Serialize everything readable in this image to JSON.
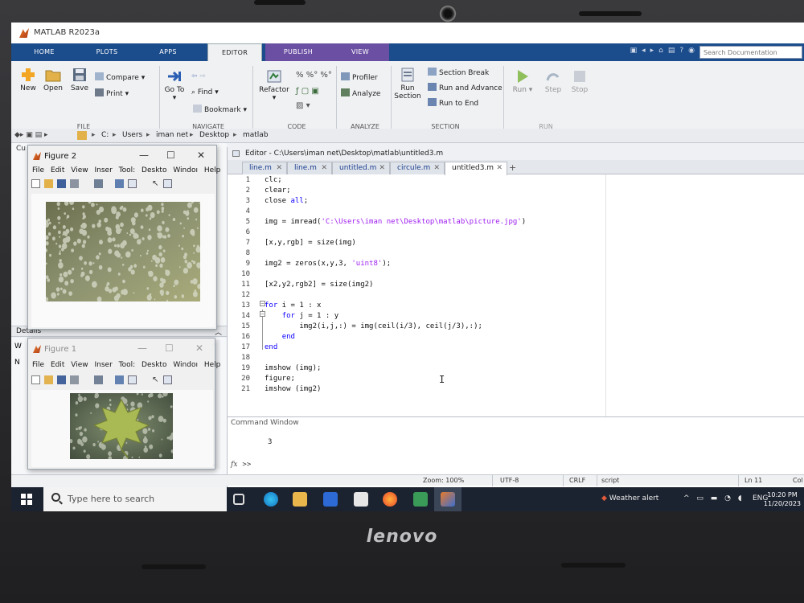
{
  "app": {
    "title": "MATLAB R2023a",
    "search_placeholder": "Search Documentation",
    "brand": "lenovo"
  },
  "tabs": [
    {
      "label": "HOME"
    },
    {
      "label": "PLOTS"
    },
    {
      "label": "APPS"
    },
    {
      "label": "EDITOR",
      "active": true
    },
    {
      "label": "PUBLISH"
    },
    {
      "label": "VIEW"
    }
  ],
  "ribbon": {
    "new": "New",
    "open": "Open",
    "save": "Save",
    "file_group": "FILE",
    "compare": "Compare",
    "print": "Print",
    "goto": "Go To",
    "find": "Find",
    "bookmark": "Bookmark",
    "navigate_group": "NAVIGATE",
    "refactor": "Refactor",
    "code_group": "CODE",
    "profiler": "Profiler",
    "analyze": "Analyze",
    "analyze_group": "ANALYZE",
    "run_section": [
      "Run",
      "Section"
    ],
    "section_break": "Section Break",
    "run_advance": "Run and Advance",
    "run_end": "Run to End",
    "section_group": "SECTION",
    "run": "Run",
    "step": "Step",
    "stop": "Stop",
    "run_group": "RUN"
  },
  "address": {
    "path": [
      "C:",
      "Users",
      "iman net",
      "Desktop",
      "matlab"
    ],
    "left_stub": "Cu"
  },
  "editor": {
    "title": "Editor - C:\\Users\\iman net\\Desktop\\matlab\\untitled3.m",
    "files": [
      {
        "name": "line.m"
      },
      {
        "name": "line.m"
      },
      {
        "name": "untitled.m"
      },
      {
        "name": "circule.m"
      },
      {
        "name": "untitled3.m",
        "active": true
      }
    ],
    "lines": [
      {
        "n": "1",
        "code": "clc;"
      },
      {
        "n": "2",
        "code": "clear;"
      },
      {
        "n": "3",
        "code": "close all;"
      },
      {
        "n": "4",
        "code": ""
      },
      {
        "n": "5",
        "code": "img = imread('C:\\Users\\iman net\\Desktop\\matlab\\picture.jpg')"
      },
      {
        "n": "6",
        "code": ""
      },
      {
        "n": "7",
        "code": "[x,y,rgb] = size(img)"
      },
      {
        "n": "8",
        "code": ""
      },
      {
        "n": "9",
        "code": "img2 = zeros(x,y,3, 'uint8');"
      },
      {
        "n": "10",
        "code": ""
      },
      {
        "n": "11",
        "code": "[x2,y2,rgb2] = size(img2)"
      },
      {
        "n": "12",
        "code": ""
      },
      {
        "n": "13",
        "code": "for i = 1 : x"
      },
      {
        "n": "14",
        "code": "    for j = 1 : y"
      },
      {
        "n": "15",
        "code": "        img2(i,j,:) = img(ceil(i/3), ceil(j/3),:);"
      },
      {
        "n": "16",
        "code": "    end"
      },
      {
        "n": "17",
        "code": "end"
      },
      {
        "n": "18",
        "code": ""
      },
      {
        "n": "19",
        "code": "imshow (img);"
      },
      {
        "n": "20",
        "code": "figure;"
      },
      {
        "n": "21",
        "code": "imshow (img2)"
      }
    ]
  },
  "command_window": {
    "title": "Command Window",
    "output": "3",
    "fx": "fx",
    "prompt": ">>"
  },
  "status": {
    "zoom": "Zoom: 100%",
    "encoding": "UTF-8",
    "eol": "CRLF",
    "type": "script",
    "ln": "Ln  11",
    "col": "Col"
  },
  "panels": {
    "details": "Details",
    "ws_stub": "W",
    "n_stub": "N"
  },
  "figure2": {
    "title": "Figure 2",
    "menu": [
      "File",
      "Edit",
      "View",
      "Inser",
      "Tool:",
      "Deskto",
      "Windoı",
      "Help"
    ]
  },
  "figure1": {
    "title": "Figure 1",
    "menu": [
      "File",
      "Edit",
      "View",
      "Inser",
      "Tool:",
      "Deskto",
      "Windoı",
      "Help"
    ]
  },
  "taskbar": {
    "search": "Type here to search",
    "weather": "Weather alert",
    "lang": "ENG",
    "time": "10:20 PM",
    "date": "11/20/2023"
  },
  "colors": {
    "keyword": "#0e00ff",
    "string": "#a020f0",
    "tab_bar": "#1b4c8c",
    "publish_tab": "#6b4fa3"
  }
}
